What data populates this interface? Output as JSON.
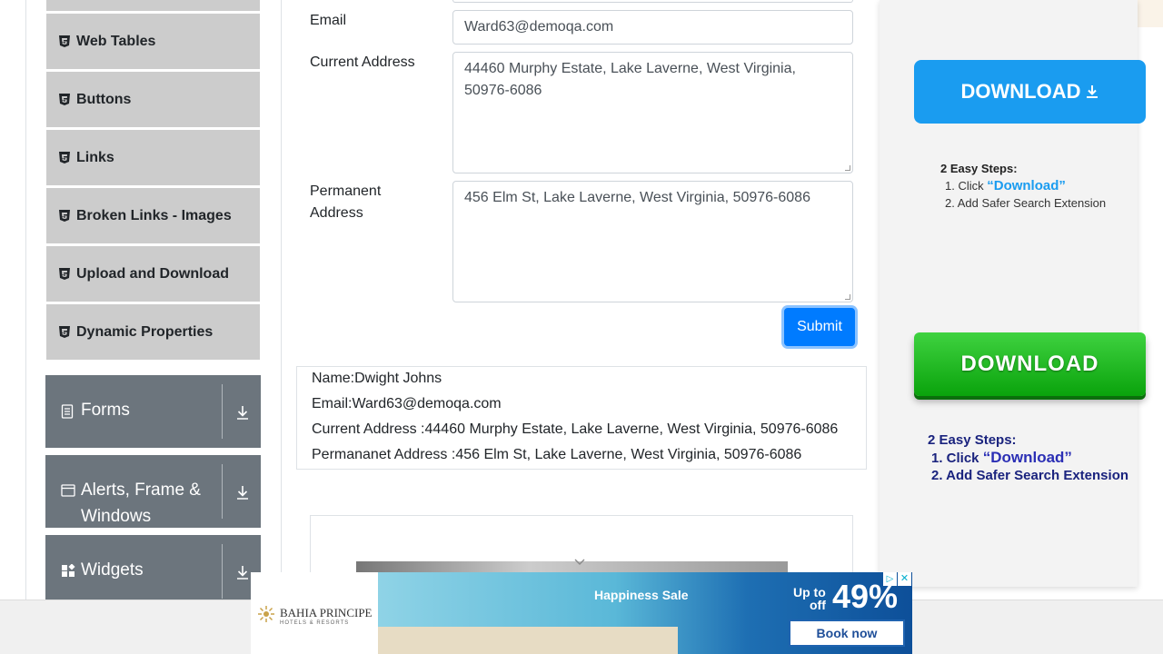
{
  "sidebar": {
    "elements_items": [
      {
        "label": "Web Tables"
      },
      {
        "label": "Buttons"
      },
      {
        "label": "Links"
      },
      {
        "label": "Broken Links - Images"
      },
      {
        "label": "Upload and Download"
      },
      {
        "label": "Dynamic Properties"
      }
    ],
    "groups": [
      {
        "label": "Forms",
        "icon": "document-icon"
      },
      {
        "label_line1": "Alerts, Frame &",
        "label_line2": "Windows",
        "icon": "window-icon"
      },
      {
        "label": "Widgets",
        "icon": "widgets-icon"
      }
    ]
  },
  "form": {
    "email_label": "Email",
    "email_value": "Ward63@demoqa.com",
    "current_address_label": "Current Address",
    "current_address_value": "44460 Murphy Estate, Lake Laverne, West Virginia, 50976-6086",
    "permanent_address_label_line1": "Permanent",
    "permanent_address_label_line2": "Address",
    "permanent_address_value": "456 Elm St, Lake Laverne, West Virginia, 50976-6086",
    "submit_label": "Submit"
  },
  "output": {
    "name": "Name:Dwight Johns",
    "email": "Email:Ward63@demoqa.com",
    "current_address": "Current Address :44460 Murphy Estate, Lake Laverne, West Virginia, 50976-6086",
    "permanent_address": "Permananet Address :456 Elm St, Lake Laverne, West Virginia, 50976-6086"
  },
  "right_ad": {
    "download_label": "DOWNLOAD",
    "steps_title": "2 Easy Steps:",
    "step1_prefix": "1. Click ",
    "step1_highlight": "“Download”",
    "step2": "2. Add Safer Search Extension",
    "download2_label": "DOWNLOAD",
    "steps2_title": "2 Easy Steps:",
    "step2_1_prefix": "1. Click ",
    "step2_1_highlight": "“Download”",
    "step2_2": "2. Add Safer Search Extension"
  },
  "bottom_ad": {
    "brand": "BAHIA PRINCIPE",
    "brand_sub": "HOTELS & RESORTS",
    "sale": "Happiness Sale",
    "up_to": "Up to",
    "off": "off",
    "percent": "49%",
    "cta": "Book now"
  },
  "colors": {
    "sidebar_item_bg": "#cccccc",
    "group_header_bg": "#6c757d",
    "primary": "#007bff",
    "download_blue": "#1a9cf0",
    "download_green": "#0aa30c"
  }
}
